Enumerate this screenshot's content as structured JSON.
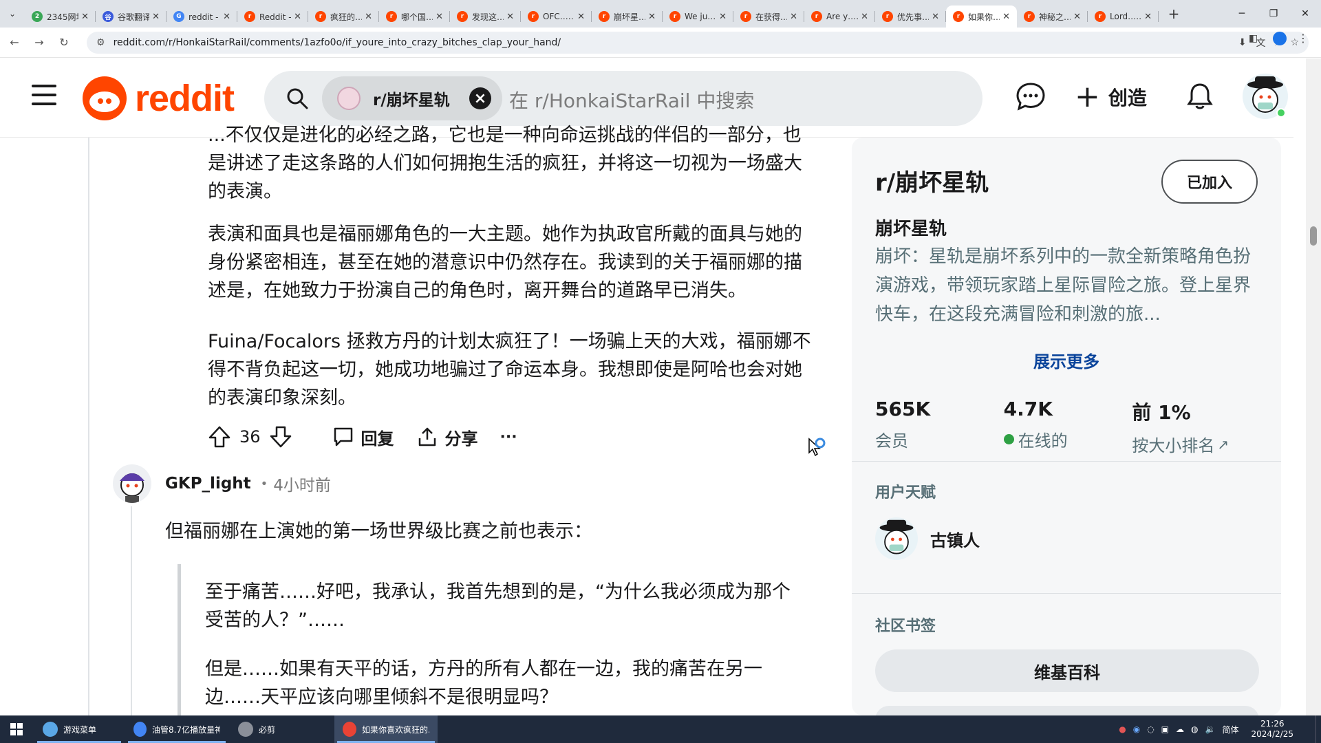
{
  "browser": {
    "tabs": [
      {
        "title": "2345网址导航",
        "color": "#3aa757",
        "glyph": "2"
      },
      {
        "title": "谷歌翻译",
        "color": "#3b5bdb",
        "glyph": "谷"
      },
      {
        "title": "reddit - Google 搜索",
        "color": "#4285f4",
        "glyph": "G"
      },
      {
        "title": "Reddit - 首页",
        "color": "#ff4500",
        "glyph": "r"
      },
      {
        "title": "疯狂的……",
        "color": "#ff4500",
        "glyph": "r"
      },
      {
        "title": "哪个国……",
        "color": "#ff4500",
        "glyph": "r"
      },
      {
        "title": "发现这……",
        "color": "#ff4500",
        "glyph": "r"
      },
      {
        "title": "OFC……",
        "color": "#ff4500",
        "glyph": "r"
      },
      {
        "title": "崩坏星……",
        "color": "#ff4500",
        "glyph": "r"
      },
      {
        "title": "We ju……",
        "color": "#ff4500",
        "glyph": "r"
      },
      {
        "title": "在获得……",
        "color": "#ff4500",
        "glyph": "r"
      },
      {
        "title": "Are y……",
        "color": "#ff4500",
        "glyph": "r"
      },
      {
        "title": "优先事……",
        "color": "#ff4500",
        "glyph": "r"
      },
      {
        "title": "如果你……",
        "color": "#ff4500",
        "glyph": "r",
        "active": true
      },
      {
        "title": "神秘之……",
        "color": "#ff4500",
        "glyph": "r"
      },
      {
        "title": "Lord……",
        "color": "#ff4500",
        "glyph": "r"
      }
    ],
    "url": "reddit.com/r/HonkaiStarRail/comments/1azfo0o/if_youre_into_crazy_bitches_clap_your_hand/"
  },
  "header": {
    "logo_text": "reddit",
    "search_chip": "r/崩坏星轨",
    "search_placeholder": "在 r/HonkaiStarRail 中搜索",
    "create_label": "创造"
  },
  "post": {
    "paragraphs": [
      "...不仅仅是进化的必经之路，它也是一种向命运挑战的伴侣的一部分，也是讲述了走这条路的人们如何拥抱生活的疯狂，并将这一切视为一场盛大的表演。",
      "表演和面具也是福丽娜角色的一大主题。她作为执政官所戴的面具与她的身份紧密相连，甚至在她的潜意识中仍然存在。我读到的关于福丽娜的描述是，在她致力于扮演自己的角色时，离开舞台的道路早已消失。",
      "Fuina/Focalors 拯救方丹的计划太疯狂了！一场骗上天的大戏，福丽娜不得不背负起这一切，她成功地骗过了命运本身。我想即使是阿哈也会对她的表演印象深刻。"
    ],
    "vote_count": "36",
    "reply_label": "回复",
    "share_label": "分享",
    "more_label": "···"
  },
  "comment": {
    "author": "GKP_light",
    "time": "4小时前",
    "body": "但福丽娜在上演她的第一场世界级比赛之前也表示：",
    "quote": [
      "至于痛苦……好吧，我承认，我首先想到的是，“为什么我必须成为那个受苦的人？”……",
      "但是……如果有天平的话，方丹的所有人都在一边，我的痛苦在另一边……天平应该向哪里倾斜不是很明显吗？"
    ]
  },
  "sidebar": {
    "title": "r/崩坏星轨",
    "joined_label": "已加入",
    "subtitle": "崩坏星轨",
    "description": "崩坏：星轨是崩坏系列中的一款全新策略角色扮演游戏，带领玩家踏上星际冒险之旅。登上星界快车，在这段充满冒险和刺激的旅...",
    "show_more": "展示更多",
    "stats": [
      {
        "value": "565K",
        "label": "会员"
      },
      {
        "value": "4.7K",
        "label": "在线的"
      },
      {
        "value": "前 1%",
        "label": "按大小排名"
      }
    ],
    "flair_heading": "用户天赋",
    "flair_name": "古镇人",
    "bookmarks_heading": "社区书签",
    "wiki_label": "维基百科"
  },
  "taskbar": {
    "items": [
      {
        "label": "游戏菜单",
        "color": "#5aa7e6"
      },
      {
        "label": "油管8.7亿播放量神...",
        "color": "#4285f4"
      },
      {
        "label": "必剪",
        "color": "#8a8f99"
      },
      {
        "label": "如果你喜欢疯狂的...",
        "color": "#ea4335",
        "active": true
      }
    ],
    "ime": "简体",
    "time": "21:26",
    "date": "2024/2/25"
  }
}
